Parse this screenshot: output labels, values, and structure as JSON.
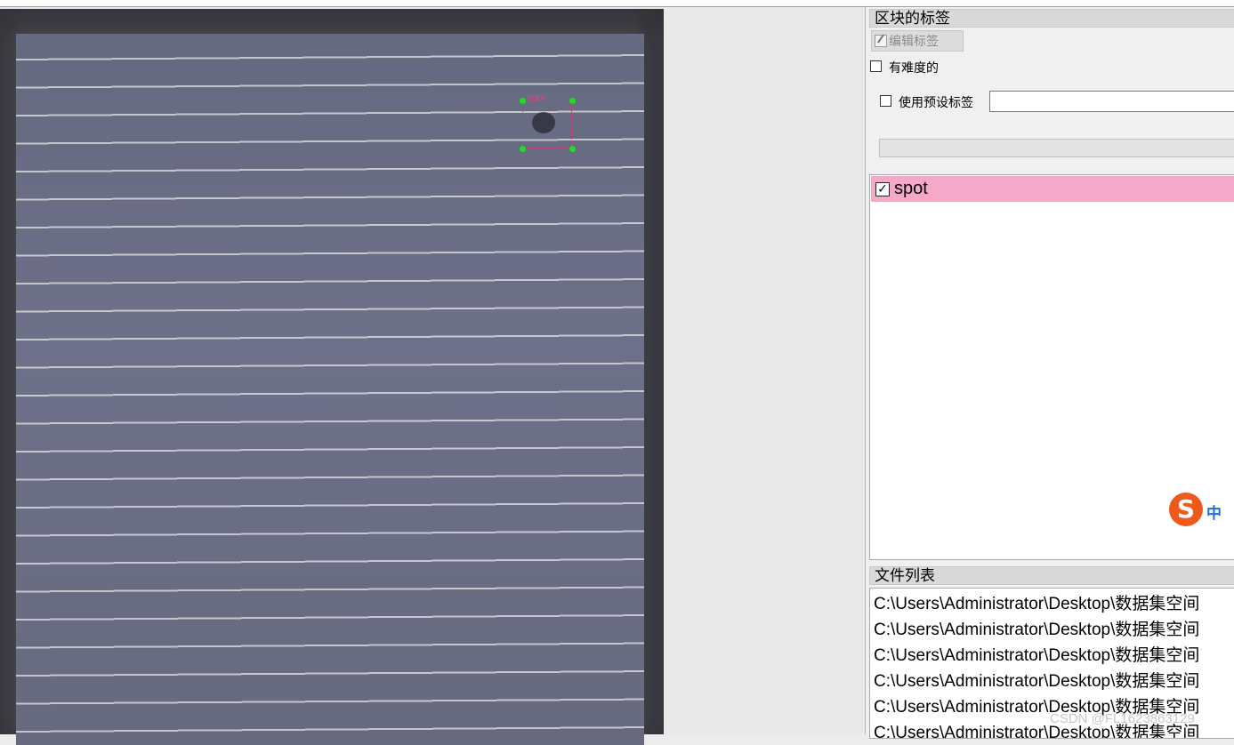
{
  "canvas": {
    "annotation_label": "spot"
  },
  "label_dock": {
    "title": "区块的标签",
    "edit_label_button": "编辑标签",
    "difficult_checkbox": {
      "label": "有难度的",
      "checked": false
    },
    "use_default_label_checkbox": {
      "label": "使用预设标签",
      "checked": false
    },
    "default_label_input": {
      "value": ""
    },
    "labels": [
      {
        "text": "spot",
        "checked": true,
        "color": "#f4a9c8"
      }
    ]
  },
  "file_dock": {
    "title": "文件列表",
    "files": [
      "C:\\Users\\Administrator\\Desktop\\数据集空间",
      "C:\\Users\\Administrator\\Desktop\\数据集空间",
      "C:\\Users\\Administrator\\Desktop\\数据集空间",
      "C:\\Users\\Administrator\\Desktop\\数据集空间",
      "C:\\Users\\Administrator\\Desktop\\数据集空间",
      "C:\\Users\\Administrator\\Desktop\\数据集空间"
    ]
  },
  "ime": {
    "logo": "S",
    "mode": "中"
  },
  "watermark": "CSDN @FL1623863129",
  "icons": [
    "edit-label-icon",
    "sogou-ime-icon"
  ]
}
